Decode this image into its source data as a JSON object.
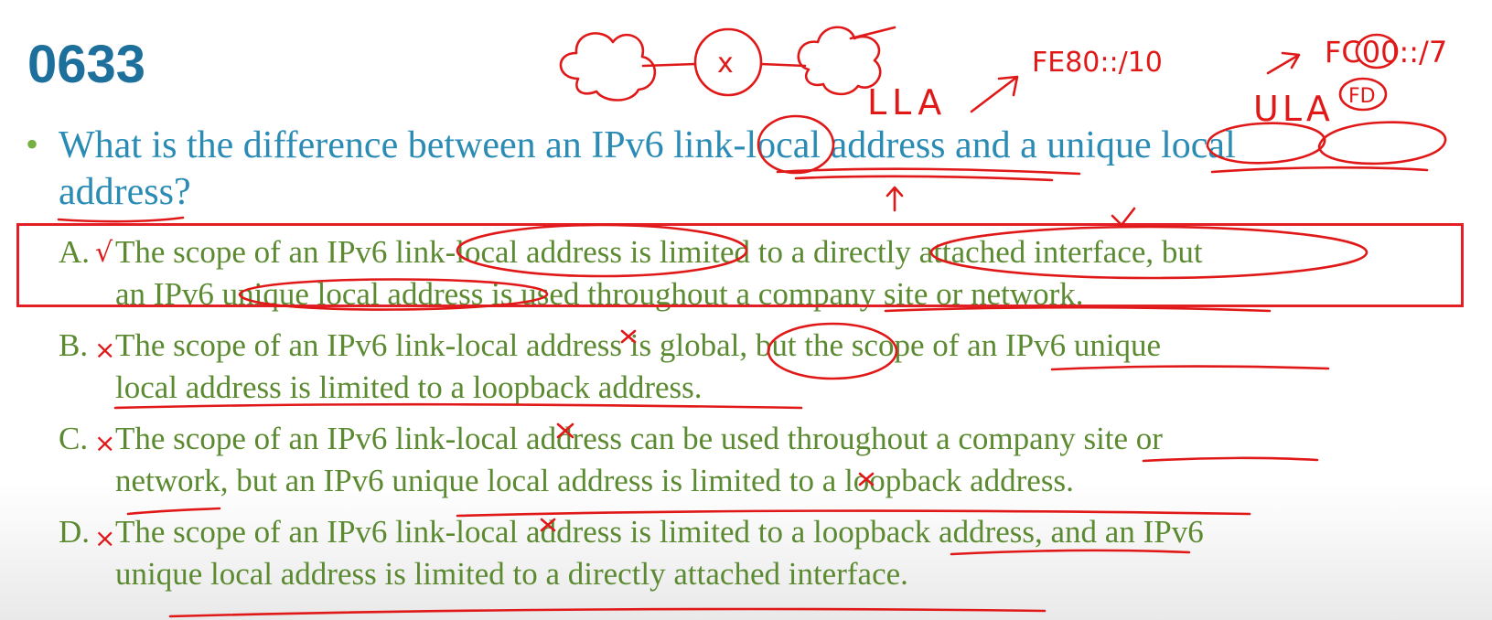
{
  "question_number": "0633",
  "question": {
    "line1": "What is the difference between an IPv6 link-local address and a unique local",
    "line2": "address?"
  },
  "options": [
    {
      "letter": "A.",
      "line1": "The scope of an IPv6 link-local address is limited to a directly attached interface, but",
      "line2": "an IPv6 unique local address is used throughout a company site or network."
    },
    {
      "letter": "B.",
      "line1": "The scope of an IPv6 link-local address is global, but the scope of an IPv6 unique",
      "line2": "local address is limited to a loopback address."
    },
    {
      "letter": "C.",
      "line1": "The scope of an IPv6 link-local address can be used throughout a company site or",
      "line2": "network, but an IPv6 unique local address is limited to a loopback address."
    },
    {
      "letter": "D.",
      "line1": "The scope of an IPv6 link-local address is limited to a loopback address, and an IPv6",
      "line2": "unique local address is limited to a directly attached interface."
    }
  ],
  "annotations": {
    "lla_label": "LLA",
    "lla_prefix": "FE80::/10",
    "ula_label": "ULA",
    "ula_prefix": "FC00::/7",
    "ula_fd": "FD",
    "router_mark": "x",
    "mark_correct": "√",
    "mark_wrong": "×"
  },
  "colors": {
    "question_number": "#1d6f9c",
    "question_text": "#2a8bb5",
    "option_text": "#5b8a31",
    "annotation_ink": "#e01818",
    "answer_box": "#e31e24"
  }
}
